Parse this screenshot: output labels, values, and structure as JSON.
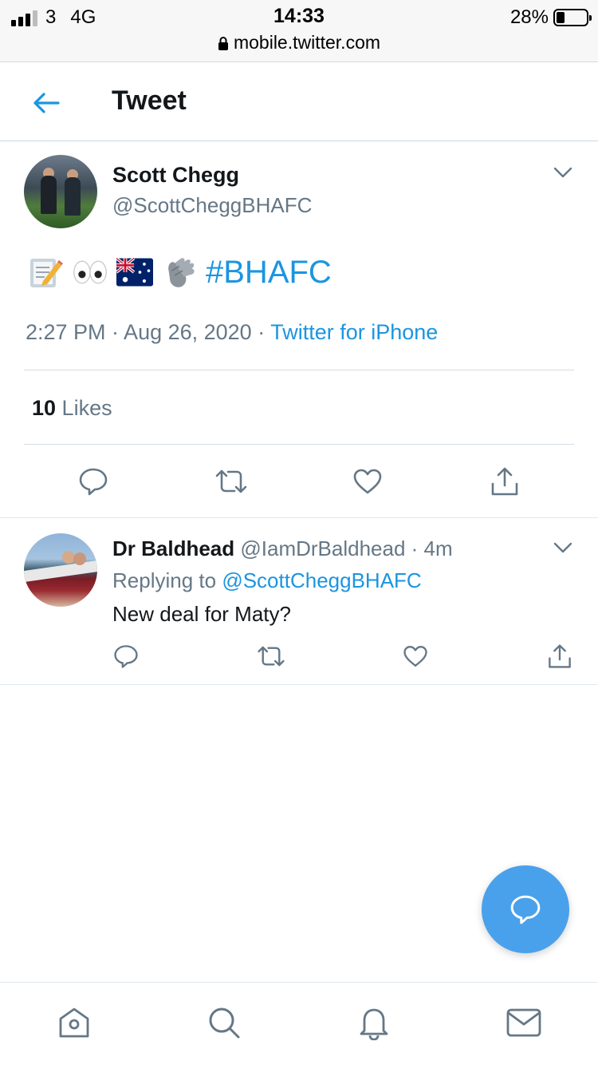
{
  "status_bar": {
    "carrier": "3",
    "network": "4G",
    "time": "14:33",
    "url": "mobile.twitter.com",
    "battery": "28%",
    "battery_level": 0.28
  },
  "header": {
    "title": "Tweet",
    "back_icon": "arrow-left-icon"
  },
  "tweet": {
    "author_name": "Scott Chegg",
    "author_handle": "@ScottCheggBHAFC",
    "emojis": [
      "memo-icon",
      "eyes-icon",
      "australia-flag-icon",
      "clapping-hands-icon"
    ],
    "hashtag": "#BHAFC",
    "timestamp": "2:27 PM · Aug 26, 2020 · ",
    "source": "Twitter for iPhone",
    "likes_count": "10",
    "likes_label": " Likes"
  },
  "reply": {
    "author_name": "Dr Baldhead",
    "author_handle": " @IamDrBaldhead · 4m",
    "replying_prefix": "Replying to ",
    "replying_to": "@ScottCheggBHAFC",
    "text": "New deal for Maty?"
  },
  "colors": {
    "accent": "#1b95e0",
    "fab": "#4aa1eb",
    "secondary_text": "#657786"
  },
  "nav": [
    "home-icon",
    "search-icon",
    "notifications-icon",
    "messages-icon"
  ]
}
